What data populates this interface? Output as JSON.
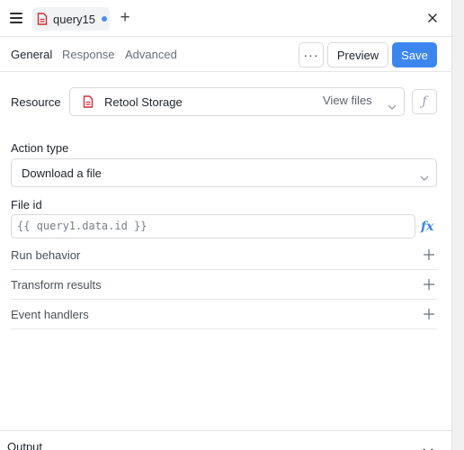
{
  "tab": {
    "title": "query15",
    "unsaved_color": "#4c8bf5"
  },
  "subtabs": {
    "general": "General",
    "response": "Response",
    "advanced": "Advanced"
  },
  "actions": {
    "more": "···",
    "preview": "Preview",
    "save": "Save",
    "save_color": "#3c86f0"
  },
  "resource": {
    "label": "Resource",
    "name": "Retool Storage",
    "view_files": "View files",
    "fx": "ƒ",
    "icon": "file-icon",
    "icon_color": "#d0303a"
  },
  "action_type": {
    "label": "Action type",
    "value": "Download a file"
  },
  "file_id": {
    "label": "File id",
    "value": "{{ query1.data.id }}",
    "fx": "fx"
  },
  "sections": {
    "run_behavior": "Run behavior",
    "transform_results": "Transform results",
    "event_handlers": "Event handlers"
  },
  "output": {
    "label": "Output"
  }
}
